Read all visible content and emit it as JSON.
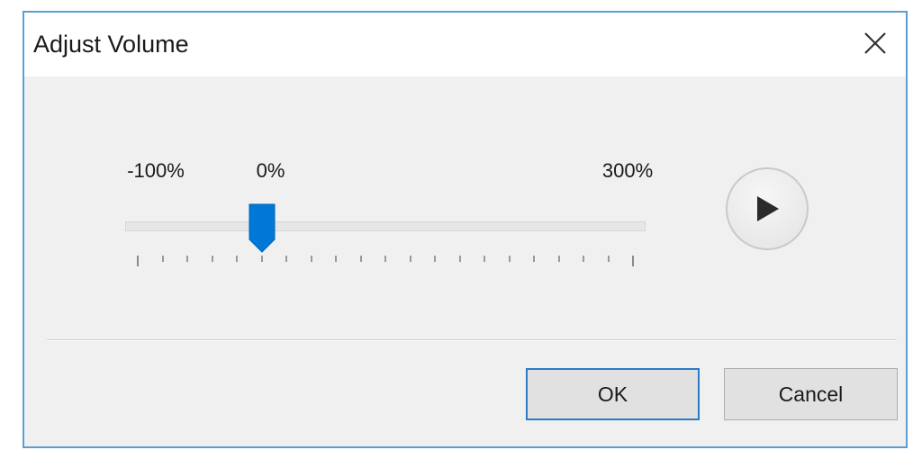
{
  "dialog": {
    "title": "Adjust Volume",
    "accent_color": "#0078d7"
  },
  "slider": {
    "min_label": "-100%",
    "current_label": "0%",
    "max_label": "300%",
    "min": -100,
    "max": 300,
    "value": 0,
    "tick_count": 21
  },
  "buttons": {
    "ok_label": "OK",
    "cancel_label": "Cancel"
  },
  "icons": {
    "close": "close-icon",
    "play": "play-icon"
  }
}
